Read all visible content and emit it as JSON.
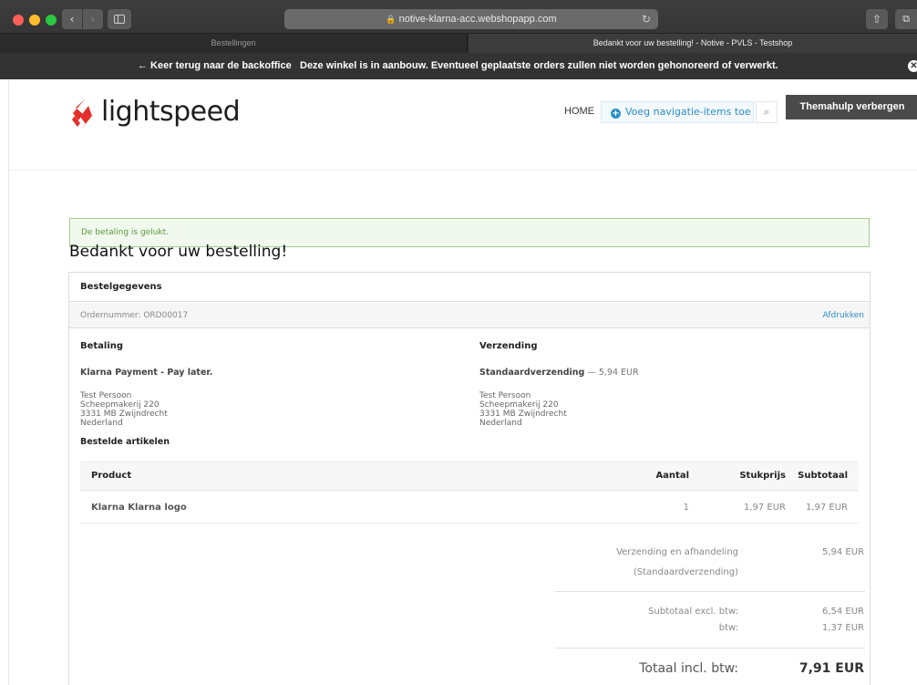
{
  "browser": {
    "url": "notive-klarna-acc.webshopapp.com",
    "tabs": [
      {
        "label": "Bestellingen"
      },
      {
        "label": "Bedankt voor uw bestelling! - Notive - PVLS - Testshop"
      }
    ]
  },
  "notice_bar": {
    "back_link": "← Keer terug naar de backoffice",
    "message": "Deze winkel is in aanbouw. Eventueel geplaatste orders zullen niet worden gehonoreerd of verwerkt."
  },
  "header": {
    "logo_text": "lightspeed",
    "nav_home": "HOME",
    "add_nav_label": "Voeg navigatie-items toe",
    "theme_help_label": "Themahulp verbergen"
  },
  "alert": {
    "text": "De betaling is gelukt."
  },
  "page_title": "Bedankt voor uw bestelling!",
  "order": {
    "panel_title": "Bestelgegevens",
    "order_number": "Ordernummer: ORD00017",
    "print_label": "Afdrukken",
    "payment": {
      "title": "Betaling",
      "method": "Klarna Payment - Pay later.",
      "address": [
        "Test Persoon",
        "Scheepmakerij 220",
        "3331 MB Zwijndrecht",
        "Nederland"
      ]
    },
    "shipping": {
      "title": "Verzending",
      "method": "Standaardverzending",
      "method_price": " — 5,94 EUR",
      "address": [
        "Test Persoon",
        "Scheepmakerij 220",
        "3331 MB Zwijndrecht",
        "Nederland"
      ]
    },
    "items_title": "Bestelde artikelen",
    "table": {
      "headers": {
        "product": "Product",
        "qty": "Aantal",
        "unit_price": "Stukprijs",
        "subtotal": "Subtotaal"
      },
      "rows": [
        {
          "product": "Klarna Klarna logo",
          "qty": "1",
          "unit_price": "1,97 EUR",
          "subtotal": "1,97 EUR"
        }
      ]
    },
    "totals": {
      "shipping_label_1": "Verzending en afhandeling",
      "shipping_label_2": "(Standaardverzending)",
      "shipping_value": "5,94 EUR",
      "subtotal_label": "Subtotaal excl. btw:",
      "subtotal_value": "6,54 EUR",
      "vat_label": "btw:",
      "vat_value": "1,37 EUR",
      "grand_label": "Totaal incl. btw:",
      "grand_value": "7,91 EUR"
    }
  },
  "colors": {
    "accent_blue": "#2b8ec8",
    "brand_red": "#e4302a",
    "alert_green": "#5a9a3a"
  }
}
